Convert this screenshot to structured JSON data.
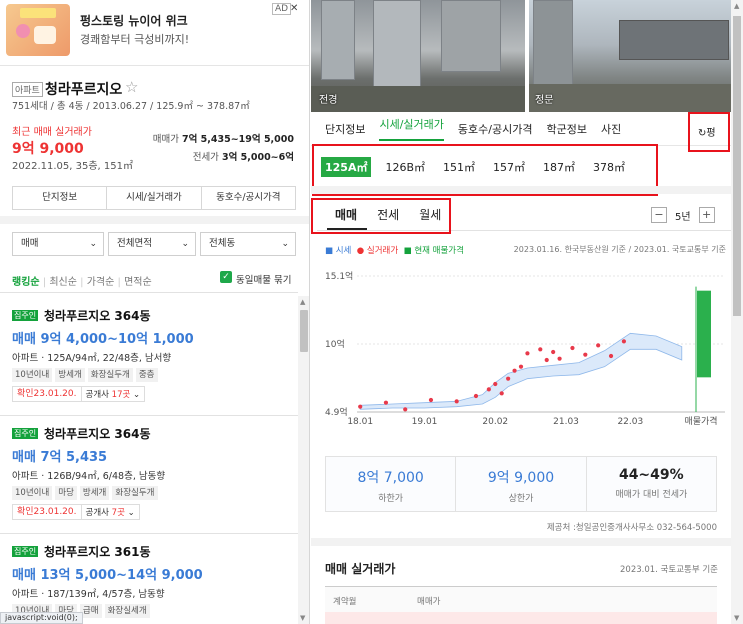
{
  "ad": {
    "title": "펑스토링 뉴이어 위크",
    "subtitle": "경쾌함부터 극성비까지!",
    "tag": "AD",
    "close": "✕"
  },
  "complex": {
    "badge": "아파트",
    "name": "청라푸르지오",
    "star": "☆",
    "meta": "751세대 / 총 4동 / 2013.06.27 / 125.9㎡ ~ 378.87㎡",
    "recent_label": "최근 매매 실거래가",
    "recent_price": "9억 9,000",
    "recent_date": "2022.11.05, 35층, 151㎡",
    "sale_range_label": "매매가",
    "sale_range": "7억 5,435~19억 5,000",
    "jeonse_range_label": "전세가",
    "jeonse_range": "3억 5,000~6억",
    "tabs": [
      "단지정보",
      "시세/실거래가",
      "동호수/공시가격"
    ]
  },
  "filters": {
    "deal": "매매",
    "area": "전체면적",
    "dong": "전체동"
  },
  "sort": {
    "items": [
      "랭킹순",
      "최신순",
      "가격순",
      "면적순"
    ],
    "active": "랭킹순",
    "same_group": "동일매물 묶기"
  },
  "listings": [
    {
      "badge": "집주인",
      "title": "청라푸르지오 364동",
      "price": "매매 9억 4,000~10억 1,000",
      "spec": "아파트 · 125A/94㎡, 22/48층, 남서향",
      "tags": [
        "10년이내",
        "방세개",
        "화장실두개",
        "중층"
      ],
      "confirm": "확인23.01.20.",
      "agents": "공개사 ",
      "agents_n": "17곳"
    },
    {
      "badge": "집주인",
      "title": "청라푸르지오 364동",
      "price": "매매 7억 5,435",
      "spec": "아파트 · 126B/94㎡, 6/48층, 남동향",
      "tags": [
        "10년이내",
        "마당",
        "방세개",
        "화장실두개"
      ],
      "confirm": "확인23.01.20.",
      "agents": "공개사 ",
      "agents_n": "7곳"
    },
    {
      "badge": "집주인",
      "title": "청라푸르지오 361동",
      "price": "매매 13억 5,000~14억 9,000",
      "spec": "아파트 · 187/139㎡, 4/57층, 남동향",
      "tags": [
        "10년이내",
        "마당",
        "급매",
        "화장실세개"
      ],
      "confirm": "확인23.01.20.",
      "agents": "공개사 ",
      "agents_n": "3곳"
    }
  ],
  "status": "javascript:void(0);",
  "photos": {
    "left": "전경",
    "right": "정문"
  },
  "nav": {
    "items": [
      "단지정보",
      "시세/실거래가",
      "동호수/공시가격",
      "학군정보",
      "사진"
    ],
    "active": "시세/실거래가",
    "refresh": "↻평"
  },
  "areas": {
    "items": [
      "125A㎡",
      "126B㎡",
      "151㎡",
      "157㎡",
      "187㎡",
      "378㎡"
    ],
    "active": "125A㎡"
  },
  "deal_tabs": {
    "items": [
      "매매",
      "전세",
      "월세"
    ],
    "active": "매매"
  },
  "period": {
    "minus": "−",
    "label": "5년",
    "plus": "+"
  },
  "legend": {
    "a": "■ 시세",
    "b": "● 실거래가",
    "c": "■ 현재 매물가격"
  },
  "source_text": "2023.01.16. 한국부동산원 기준 / 2023.01. 국토교통부 기준",
  "chart_data": {
    "type": "scatter",
    "y_tick_labels": [
      "15.1억",
      "10억",
      "4.9억"
    ],
    "y_ticks": [
      15.1,
      10,
      4.9
    ],
    "x_tick_labels": [
      "18.01",
      "19.01",
      "20.02",
      "21.03",
      "22.03",
      "매물가격"
    ],
    "ylim": [
      4.9,
      15.1
    ],
    "series": [
      {
        "name": "시세",
        "type": "band",
        "x": [
          2018.0,
          2018.5,
          2019.0,
          2019.5,
          2019.9,
          2020.1,
          2020.3,
          2020.6,
          2021.0,
          2021.4,
          2021.8,
          2022.2,
          2022.6,
          2023.0
        ],
        "low": [
          5.1,
          5.2,
          5.2,
          5.3,
          5.5,
          6.0,
          6.8,
          7.4,
          7.6,
          7.7,
          8.3,
          9.6,
          9.6,
          8.8
        ],
        "high": [
          5.4,
          5.5,
          5.6,
          5.7,
          6.2,
          7.1,
          7.8,
          8.2,
          8.4,
          8.6,
          9.5,
          10.8,
          10.6,
          9.8
        ]
      },
      {
        "name": "실거래가",
        "type": "points",
        "x": [
          2018.0,
          2018.4,
          2018.7,
          2019.1,
          2019.5,
          2019.8,
          2020.0,
          2020.1,
          2020.2,
          2020.3,
          2020.4,
          2020.5,
          2020.6,
          2020.8,
          2020.9,
          2021.0,
          2021.1,
          2021.3,
          2021.5,
          2021.7,
          2021.9,
          2022.1
        ],
        "y": [
          5.3,
          5.6,
          5.1,
          5.8,
          5.7,
          6.1,
          6.6,
          7.0,
          6.3,
          7.4,
          8.0,
          8.3,
          9.3,
          9.6,
          8.8,
          9.4,
          8.9,
          9.7,
          9.2,
          9.9,
          9.1,
          10.2
        ]
      },
      {
        "name": "현재 매물가격",
        "type": "bar",
        "low": 7.5,
        "high": 14.0
      }
    ]
  },
  "stats": [
    {
      "value": "8억 7,000",
      "label": "하한가"
    },
    {
      "value": "9억 9,000",
      "label": "상한가"
    },
    {
      "value": "44~49%",
      "label": "매매가 대비 전세가"
    }
  ],
  "contact": "제공처 :청일공인중개사사무소 032-564-5000",
  "deal_section": {
    "title": "매매 실거래가",
    "source": "2023.01. 국토교통부 기준",
    "col1": "계약월",
    "col2": "매매가"
  }
}
